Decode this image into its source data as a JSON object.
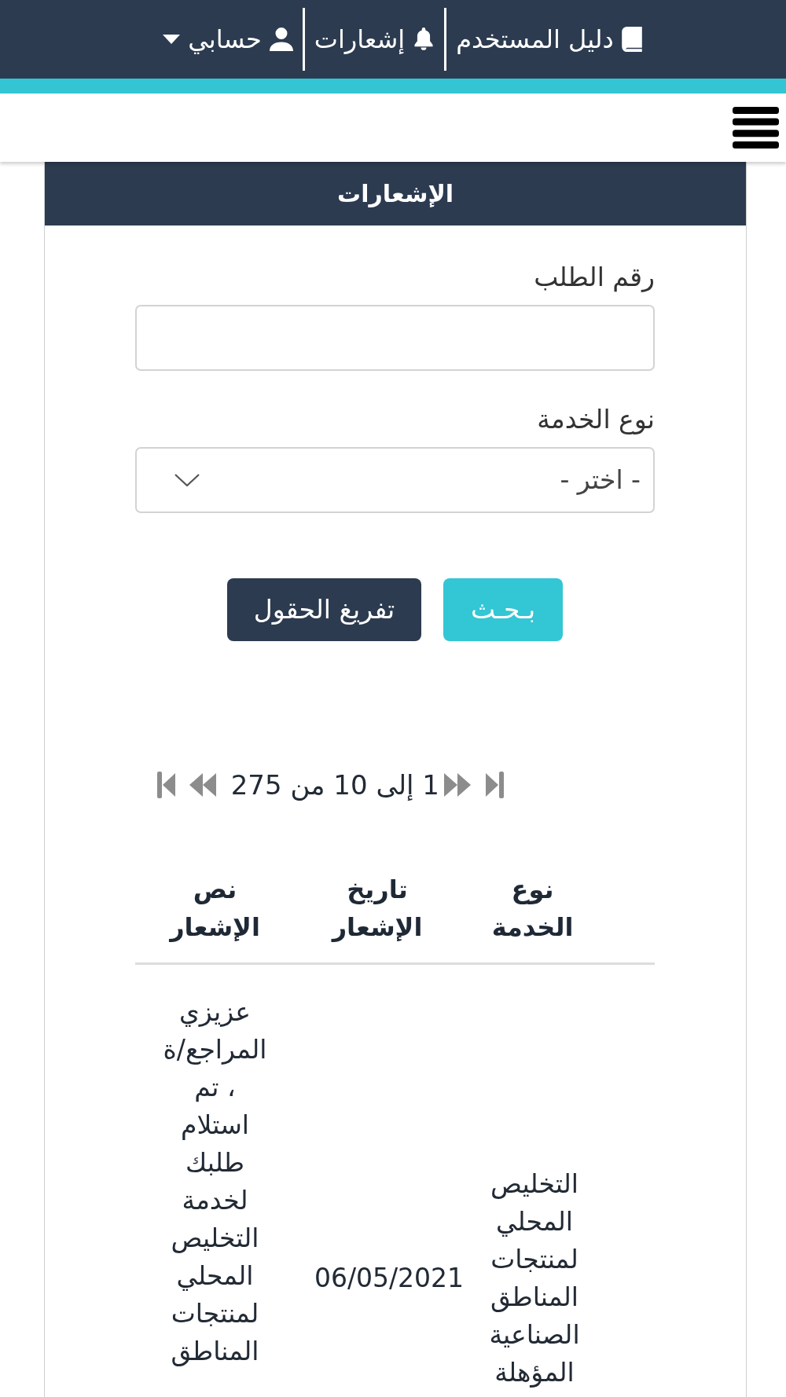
{
  "top_bar": {
    "nav": [
      {
        "kind": "guide",
        "label": "دليل المستخدم"
      },
      {
        "kind": "notifications",
        "label": "إشعارات"
      },
      {
        "kind": "account",
        "label": "حسابي"
      }
    ]
  },
  "panel": {
    "title": "الإشعارات",
    "fields": [
      {
        "kind": "text",
        "label": "رقم الطلب"
      },
      {
        "kind": "select",
        "label": "نوع الخدمة",
        "value": "- اختر -"
      }
    ],
    "buttons": [
      {
        "kind": "primary",
        "label": "بـحـث"
      },
      {
        "kind": "secondary",
        "label": "تفريغ الحقول"
      }
    ],
    "pagination": {
      "summary": "1 إلى 10 من 275"
    },
    "table": {
      "columns": [
        "نوع الخدمة",
        "تاريخ الإشعار",
        "نص الإشعار"
      ],
      "rows": [
        {
          "service_type": "التخليص المحلي لمنتجات المناطق الصناعية المؤهلة",
          "date": "06/05/2021",
          "text": "عزيزي المراجع/ة ، تم استلام طلبك لخدمة التخليص المحلي لمنتجات المناطق"
        }
      ]
    }
  }
}
